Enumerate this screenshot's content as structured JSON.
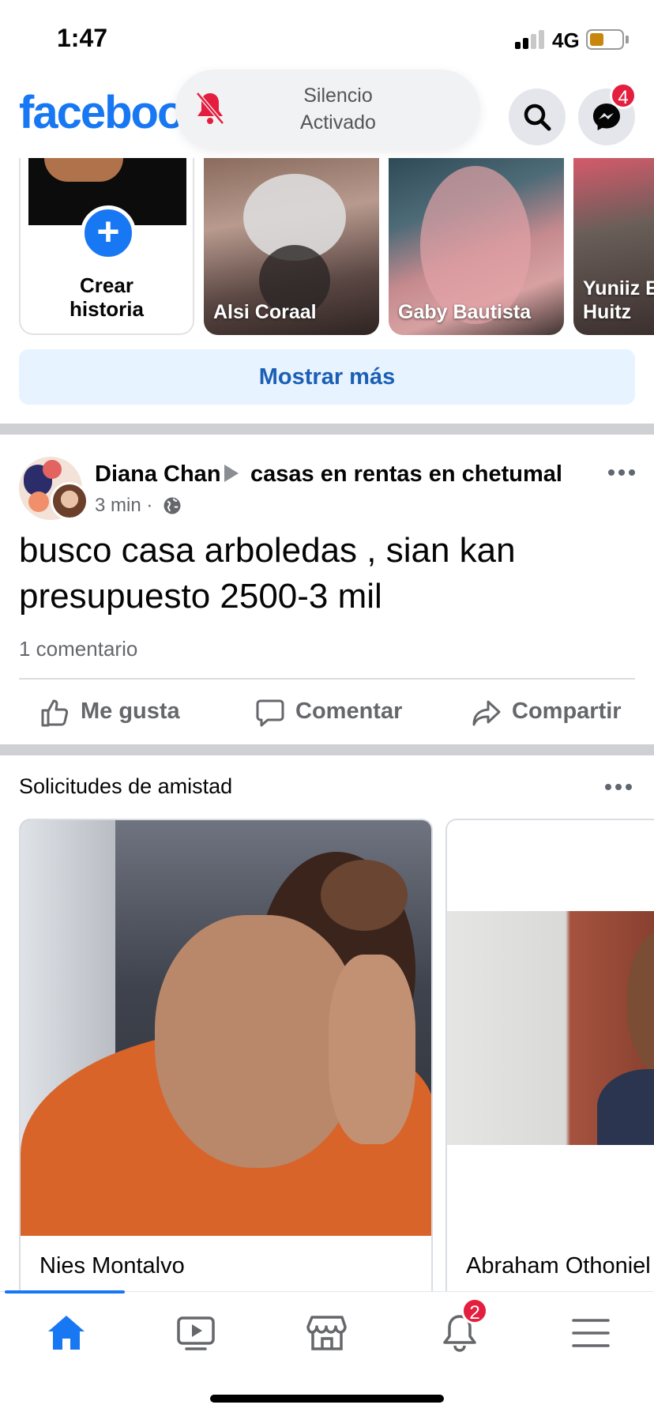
{
  "status_bar": {
    "time": "1:47",
    "network": "4G",
    "battery_level": 0.45,
    "signal_bars_active": 2,
    "signal_bars_total": 4
  },
  "header": {
    "logo_text": "facebook",
    "silence_line1": "Silencio",
    "silence_line2": "Activado",
    "search_icon": "search-icon",
    "messenger_icon": "messenger-icon",
    "messenger_badge": "4",
    "brand_color": "#1877f2"
  },
  "stories": {
    "create_line1": "Crear",
    "create_line2": "historia",
    "items": [
      {
        "name": "Alsi Coraal"
      },
      {
        "name": "Gaby Bautista"
      },
      {
        "name_line1": "Yuniiz E",
        "name_line2": "Huitz"
      }
    ]
  },
  "show_more": "Mostrar más",
  "post": {
    "author": "Diana Chan",
    "group": "casas en rentas en chetumal",
    "time": "3 min ·",
    "privacy_icon": "globe-icon",
    "text": "busco casa arboledas , sian kan presupuesto 2500-3 mil",
    "comments": "1 comentario",
    "actions": {
      "like": "Me gusta",
      "comment": "Comentar",
      "share": "Compartir"
    }
  },
  "friend_requests": {
    "title": "Solicitudes de amistad",
    "people": [
      {
        "name": "Nies Montalvo"
      },
      {
        "name": "Abraham Othoniel"
      }
    ]
  },
  "bottom_nav": {
    "items": [
      "home-icon",
      "video-icon",
      "marketplace-icon",
      "notifications-icon",
      "menu-icon"
    ],
    "active": "home-icon",
    "notifications_badge": "2"
  }
}
